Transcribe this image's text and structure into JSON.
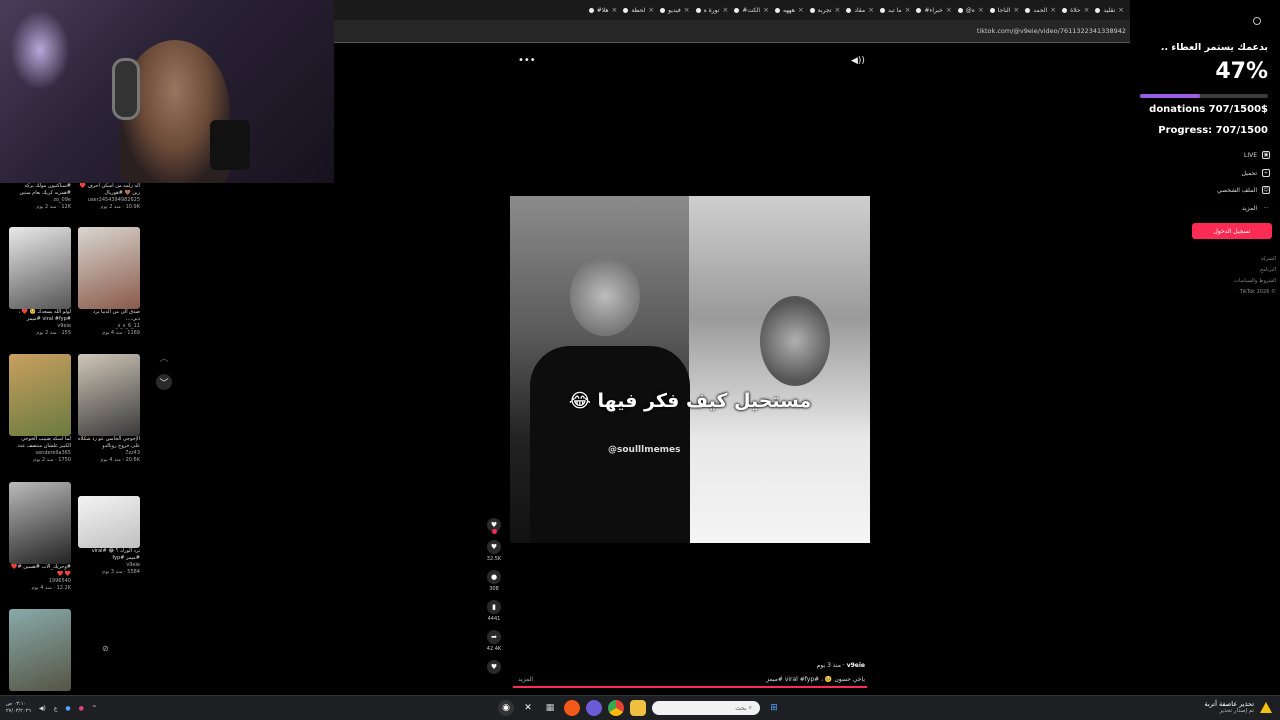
{
  "browser": {
    "tabs": [
      "تقليد",
      "حلاة",
      "الحمد",
      "الناجا",
      "@ه",
      "#خبراء",
      "ما تبد",
      "مقاد",
      "تجربة",
      "هههه",
      "#الكت",
      "تورة ه",
      "فيديو",
      "لحظة",
      "#هلا"
    ],
    "url": "tiktok.com/@v9eie/video/7611322341338942"
  },
  "left_grid": [
    {
      "caption": "اله زلمه من اسكن احرف ❤️ زين 🤎 #هوريال",
      "author": "user2454394982625",
      "meta": "10.9K · منذ 2 يوم",
      "colors": [
        "#222",
        "#444"
      ]
    },
    {
      "caption": "#سناكتيون مولك بركة #همريه كريك بعام سنين",
      "author": "zo_09e",
      "meta": "12K · منذ 2 يوم",
      "colors": [
        "#111",
        "#333"
      ]
    },
    {
      "caption": "صدق الي من الدنيا يرد دبي....",
      "author": "s_s_6_11_",
      "meta": "1169 · منذ 4 يوم",
      "colors": [
        "#d9d6d0",
        "#8a5a4a"
      ]
    },
    {
      "caption": "لولو الله يسعدك 🥺 ❤️ ، #viral #fyp #ميمز",
      "author": "v9eie",
      "meta": "155 · منذ 2 يوم",
      "colors": [
        "#eaeaea",
        "#555"
      ]
    },
    {
      "caption": "الإحوجي الخاسن عو رد شكلاه على خروج رونالدو",
      "author": "7zz43",
      "meta": "20.6K · منذ 4 يوم",
      "colors": [
        "#cfc7b8",
        "#3a3a3a"
      ]
    },
    {
      "caption": "لما اسكه ضبيب الخوجي الكبير علشان منتصف عدد",
      "author": "senderella365",
      "meta": "1750 · منذ 2 يوم",
      "colors": [
        "#c8a060",
        "#6a7a40"
      ]
    },
    {
      "caption": "ترد الورك ؟ 😂 #viral #ميمز #fyp",
      "author": "v9eie",
      "meta": "5584 · منذ 3 يوم",
      "colors": [
        "#f4f4f4",
        "#c0c0c0"
      ]
    },
    {
      "caption": "#وحريك_الاب #هسين #❤️ ❤️ ❤️",
      "author": "1996540",
      "meta": "12.2K · منذ 4 يوم",
      "colors": [
        "#bbb",
        "#222"
      ]
    },
    {
      "caption": "",
      "author": "",
      "meta": "",
      "colors": [
        "#8aa",
        "#554"
      ]
    }
  ],
  "video": {
    "caption": "مستحيل كيف فكر فيها 😂",
    "watermark": "@soulllmemes",
    "author": "v9eie",
    "age": "منذ 3 يوم",
    "description": "ياخي حسون 🥺 ، #viral #fyp #ميمز",
    "more": "المزيد",
    "progress": 1.0
  },
  "actions": {
    "likes": "32.5K",
    "comments": "308",
    "saves": "4441",
    "shares": "42.4K"
  },
  "donation": {
    "title": "بدعمك يستمر العطاء ..",
    "percent": "47%",
    "fraction": 0.47,
    "amount": "donations 707/1500$",
    "progress": "Progress: 707/1500"
  },
  "sidebar": {
    "items": [
      {
        "label": "LIVE",
        "icon": "live-icon",
        "glyph": "▣"
      },
      {
        "label": "تحميل",
        "icon": "upload-icon",
        "glyph": "+"
      },
      {
        "label": "الملف الشخصي",
        "icon": "profile-icon",
        "glyph": "☺"
      },
      {
        "label": "المزيد",
        "icon": "more-icon",
        "glyph": "⋯"
      }
    ],
    "login": "تسجيل الدخول",
    "footer": [
      "الشركة",
      "البرنامج",
      "الشروط والسياسات",
      "© TikTok 2026"
    ]
  },
  "taskbar": {
    "time": "٠٣:١٠ ص",
    "date": "٢٧/٠٣/٢٠٢٦",
    "lang": "ع",
    "search_placeholder": "بحث",
    "alert_title": "تحذير عاصفة أتربة",
    "alert_sub": "تم إصدار تحذير"
  }
}
